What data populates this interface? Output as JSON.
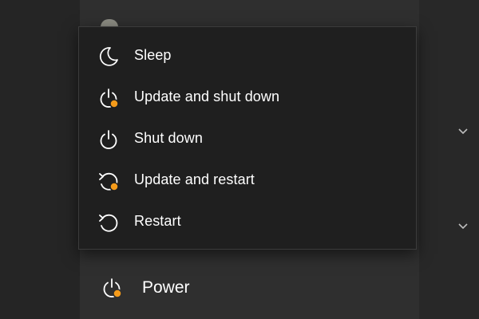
{
  "power_menu": {
    "items": [
      {
        "label": "Sleep",
        "icon": "moon-icon",
        "update_badge": false
      },
      {
        "label": "Update and shut down",
        "icon": "power-update-icon",
        "update_badge": true
      },
      {
        "label": "Shut down",
        "icon": "power-icon",
        "update_badge": false
      },
      {
        "label": "Update and restart",
        "icon": "restart-update-icon",
        "update_badge": true
      },
      {
        "label": "Restart",
        "icon": "restart-icon",
        "update_badge": false
      }
    ]
  },
  "power_button": {
    "label": "Power",
    "icon": "power-update-icon",
    "update_badge": true
  },
  "colors": {
    "update_badge": "#f59b1a",
    "flyout_bg": "#1f1f1f",
    "text": "#ffffff"
  }
}
